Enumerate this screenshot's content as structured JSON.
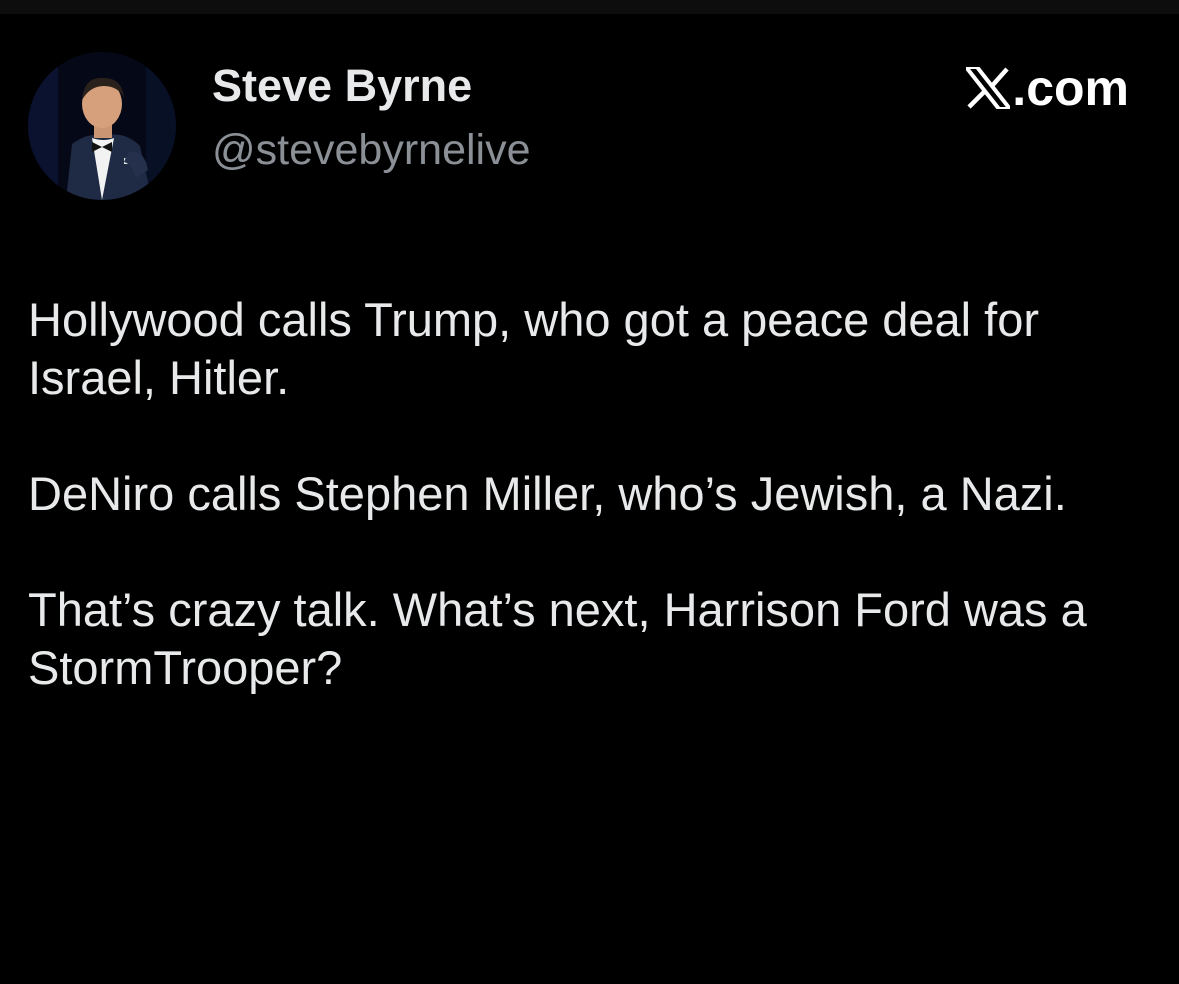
{
  "author": {
    "display_name": "Steve Byrne",
    "handle": "@stevebyrnelive",
    "avatar_icon": "profile-photo"
  },
  "brand": {
    "icon": "x-logo-icon",
    "label": ".com"
  },
  "tweet": {
    "paragraphs": [
      "Hollywood calls Trump, who got a peace deal for Israel, Hitler.",
      "DeNiro calls Stephen Miller, who’s Jewish, a Nazi.",
      "That’s crazy talk. What’s next, Harrison Ford was a StormTrooper?"
    ]
  },
  "colors": {
    "background": "#000000",
    "primary_text": "#e7e9ea",
    "secondary_text": "#8b9096"
  }
}
